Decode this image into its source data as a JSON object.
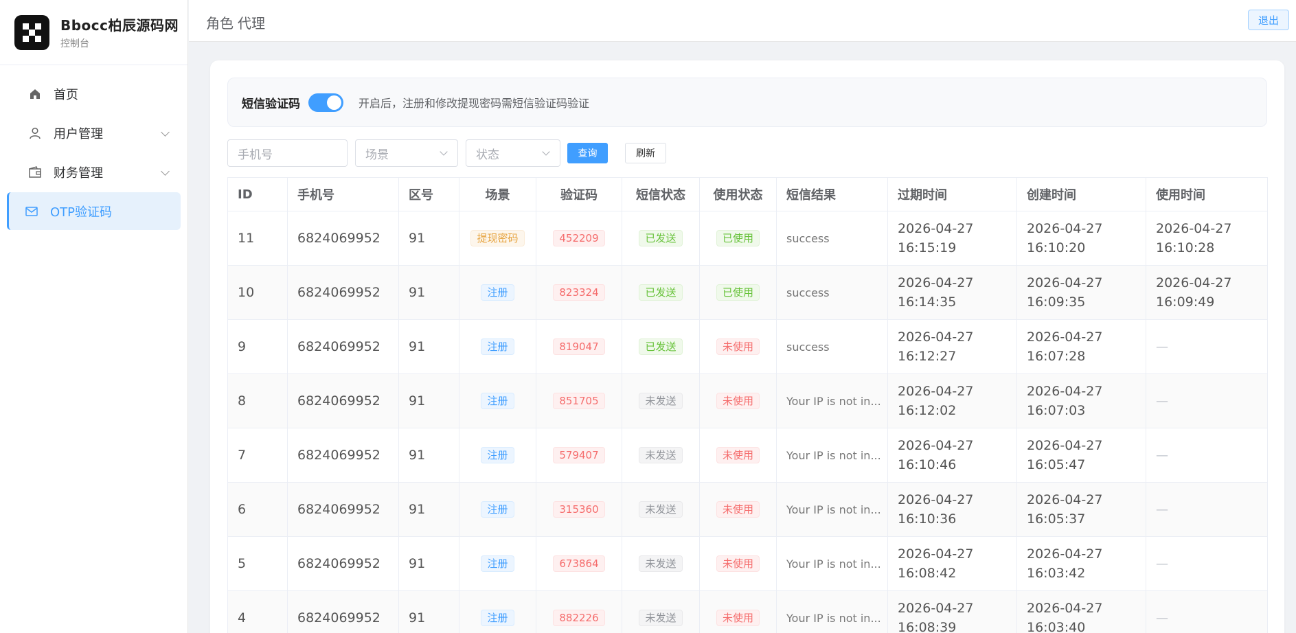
{
  "brand": {
    "title": "Bbocc柏辰源码网",
    "subtitle": "控制台"
  },
  "sidebar": {
    "items": [
      {
        "label": "首页",
        "icon": "home-icon"
      },
      {
        "label": "用户管理",
        "icon": "user-icon"
      },
      {
        "label": "财务管理",
        "icon": "wallet-icon"
      },
      {
        "label": "OTP验证码",
        "icon": "mail-icon"
      }
    ]
  },
  "topbar": {
    "crumb_role": "角色",
    "crumb_value": "代理",
    "logout": "退出"
  },
  "sms": {
    "title": "短信验证码",
    "enabled": true,
    "desc": "开启后，注册和修改提现密码需短信验证码验证"
  },
  "filters": {
    "phone_placeholder": "手机号",
    "scene_placeholder": "场景",
    "status_placeholder": "状态",
    "query": "查询",
    "refresh": "刷新"
  },
  "table": {
    "headers": [
      "ID",
      "手机号",
      "区号",
      "场景",
      "验证码",
      "短信状态",
      "使用状态",
      "短信结果",
      "过期时间",
      "创建时间",
      "使用时间"
    ],
    "rows": [
      {
        "id": "11",
        "phone": "6824069952",
        "area": "91",
        "scene": "提现密码",
        "code": "452209",
        "sms": "已发送",
        "use": "已使用",
        "result": "success",
        "exp1": "2026-04-27",
        "exp2": "16:15:19",
        "cre1": "2026-04-27",
        "cre2": "16:10:20",
        "used1": "2026-04-27",
        "used2": "16:10:28"
      },
      {
        "id": "10",
        "phone": "6824069952",
        "area": "91",
        "scene": "注册",
        "code": "823324",
        "sms": "已发送",
        "use": "已使用",
        "result": "success",
        "exp1": "2026-04-27",
        "exp2": "16:14:35",
        "cre1": "2026-04-27",
        "cre2": "16:09:35",
        "used1": "2026-04-27",
        "used2": "16:09:49"
      },
      {
        "id": "9",
        "phone": "6824069952",
        "area": "91",
        "scene": "注册",
        "code": "819047",
        "sms": "已发送",
        "use": "未使用",
        "result": "success",
        "exp1": "2026-04-27",
        "exp2": "16:12:27",
        "cre1": "2026-04-27",
        "cre2": "16:07:28",
        "used1": "—",
        "used2": ""
      },
      {
        "id": "8",
        "phone": "6824069952",
        "area": "91",
        "scene": "注册",
        "code": "851705",
        "sms": "未发送",
        "use": "未使用",
        "result": "Your IP is not in...",
        "exp1": "2026-04-27",
        "exp2": "16:12:02",
        "cre1": "2026-04-27",
        "cre2": "16:07:03",
        "used1": "—",
        "used2": ""
      },
      {
        "id": "7",
        "phone": "6824069952",
        "area": "91",
        "scene": "注册",
        "code": "579407",
        "sms": "未发送",
        "use": "未使用",
        "result": "Your IP is not in...",
        "exp1": "2026-04-27",
        "exp2": "16:10:46",
        "cre1": "2026-04-27",
        "cre2": "16:05:47",
        "used1": "—",
        "used2": ""
      },
      {
        "id": "6",
        "phone": "6824069952",
        "area": "91",
        "scene": "注册",
        "code": "315360",
        "sms": "未发送",
        "use": "未使用",
        "result": "Your IP is not in...",
        "exp1": "2026-04-27",
        "exp2": "16:10:36",
        "cre1": "2026-04-27",
        "cre2": "16:05:37",
        "used1": "—",
        "used2": ""
      },
      {
        "id": "5",
        "phone": "6824069952",
        "area": "91",
        "scene": "注册",
        "code": "673864",
        "sms": "未发送",
        "use": "未使用",
        "result": "Your IP is not in...",
        "exp1": "2026-04-27",
        "exp2": "16:08:42",
        "cre1": "2026-04-27",
        "cre2": "16:03:42",
        "used1": "—",
        "used2": ""
      },
      {
        "id": "4",
        "phone": "6824069952",
        "area": "91",
        "scene": "注册",
        "code": "882226",
        "sms": "未发送",
        "use": "未使用",
        "result": "Your IP is not in...",
        "exp1": "2026-04-27",
        "exp2": "16:08:39",
        "cre1": "2026-04-27",
        "cre2": "16:03:40",
        "used1": "—",
        "used2": ""
      }
    ]
  },
  "colors": {
    "primary": "#409eff",
    "danger": "#f56c6c",
    "success": "#67c23a",
    "warning": "#e6a23c",
    "info": "#909399"
  }
}
